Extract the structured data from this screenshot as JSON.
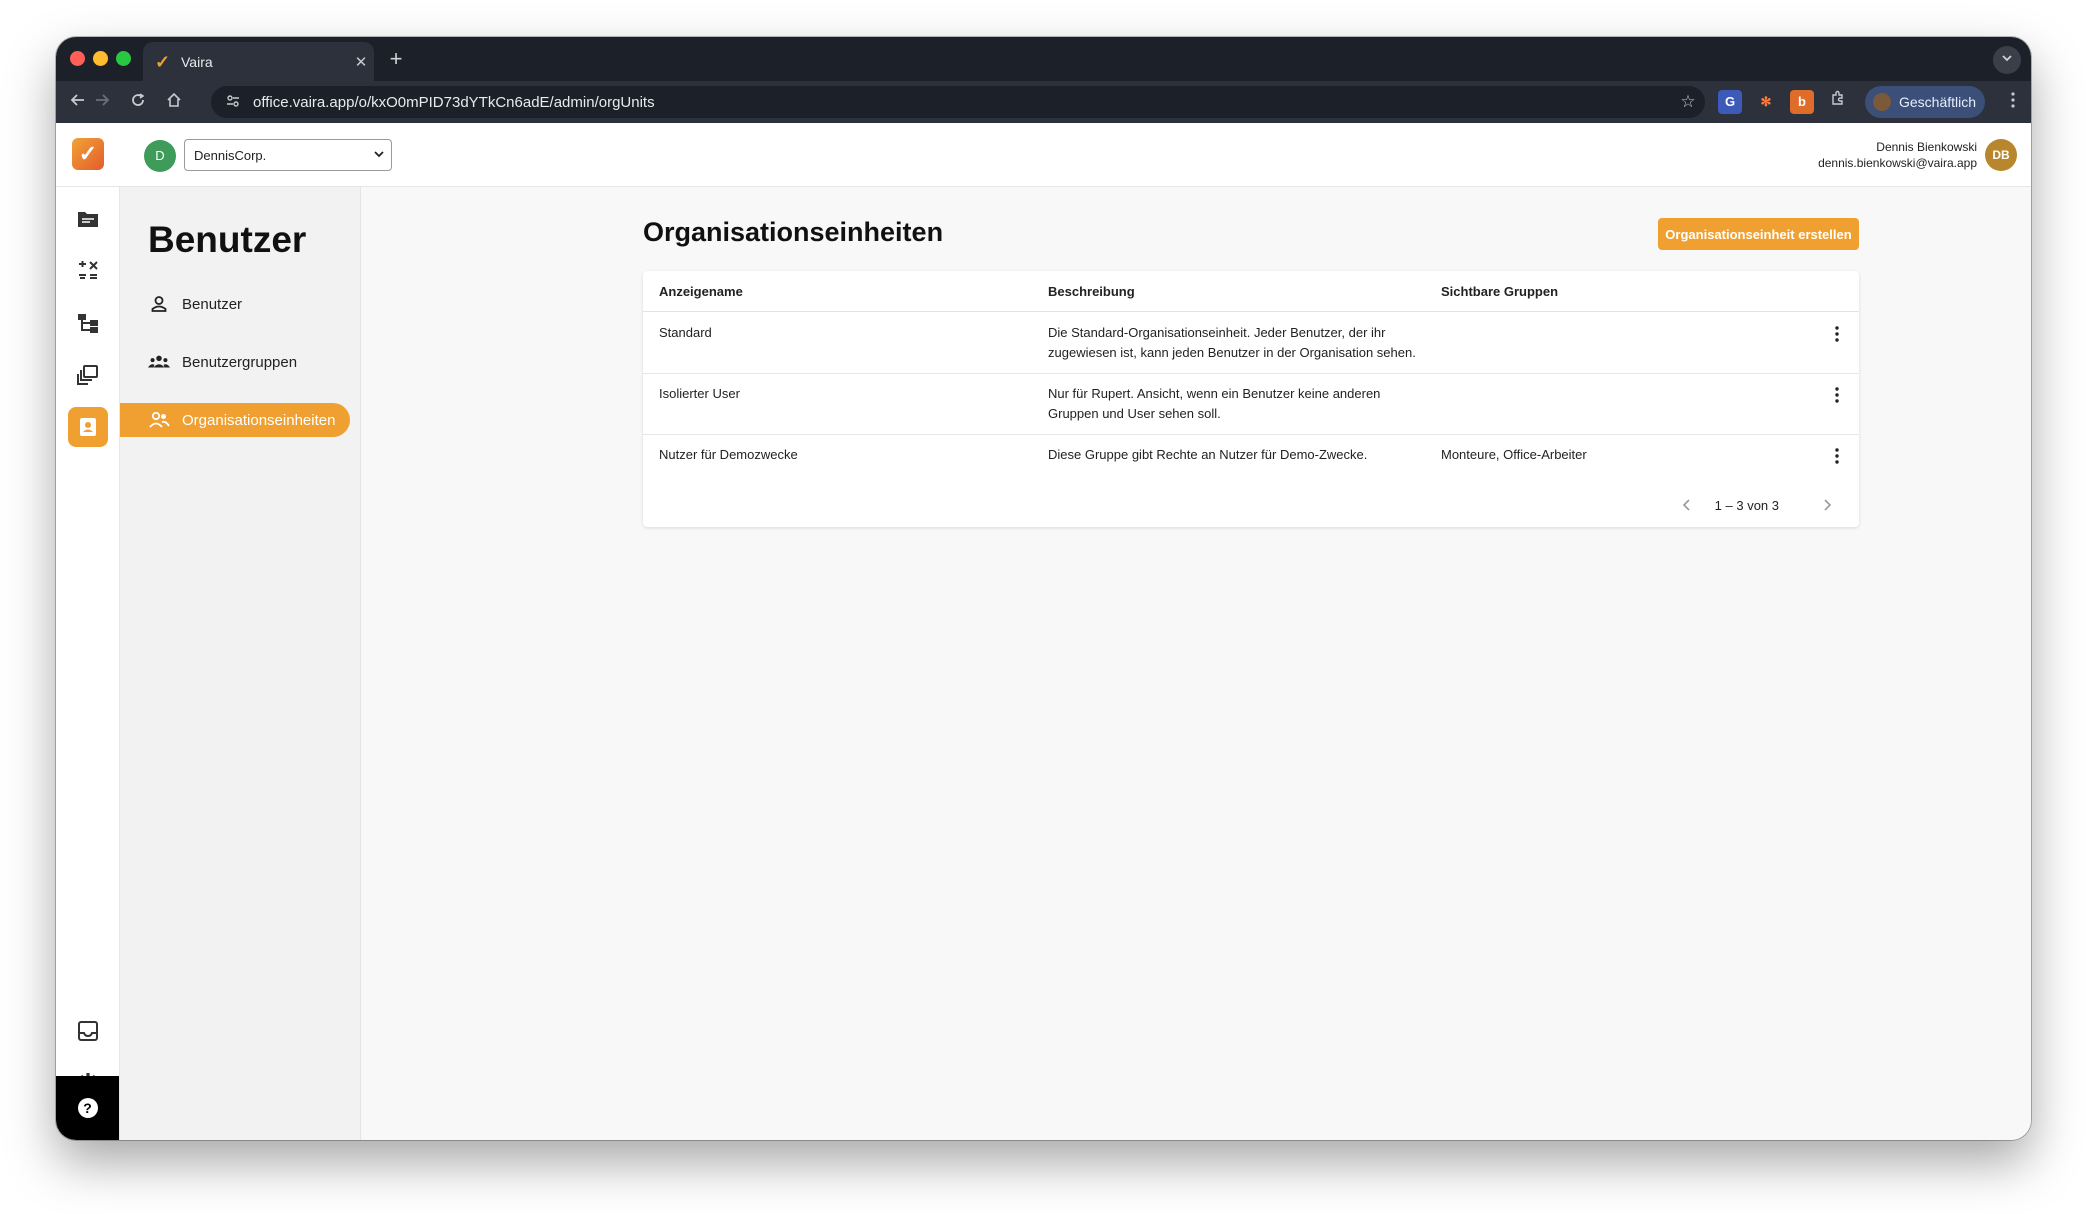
{
  "browser": {
    "tab_title": "Vaira",
    "tab_close": "✕",
    "new_tab": "+",
    "url": "office.vaira.app/o/kxO0mPID73dYTkCn6adE/admin/orgUnits",
    "profile_label": "Geschäftlich"
  },
  "header": {
    "org_avatar": "D",
    "org_name": "DennisCorp.",
    "user_name": "Dennis Bienkowski",
    "user_email": "dennis.bienkowski@vaira.app",
    "user_initials": "DB"
  },
  "subnav": {
    "title": "Benutzer",
    "items": [
      {
        "label": "Benutzer"
      },
      {
        "label": "Benutzergruppen"
      },
      {
        "label": "Organisationseinheiten"
      }
    ]
  },
  "main": {
    "title": "Organisationseinheiten",
    "create_label": "Organisationseinheit erstellen",
    "columns": [
      "Anzeigename",
      "Beschreibung",
      "Sichtbare Gruppen"
    ],
    "rows": [
      {
        "name": "Standard",
        "description": "Die Standard-Organisationseinheit. Jeder Benutzer, der ihr zugewiesen ist, kann jeden Benutzer in der Organisation sehen.",
        "groups": ""
      },
      {
        "name": "Isolierter User",
        "description": "Nur für Rupert. Ansicht, wenn ein Benutzer keine anderen Gruppen und User sehen soll.",
        "groups": ""
      },
      {
        "name": "Nutzer für Demozwecke",
        "description": "Diese Gruppe gibt Rechte an Nutzer für Demo-Zwecke.",
        "groups": "Monteure, Office-Arbeiter"
      }
    ],
    "pagination": "1 – 3 von 3"
  },
  "colors": {
    "accent": "#f0a030",
    "org_avatar": "#3e9b5a",
    "user_avatar": "#b8862c"
  }
}
